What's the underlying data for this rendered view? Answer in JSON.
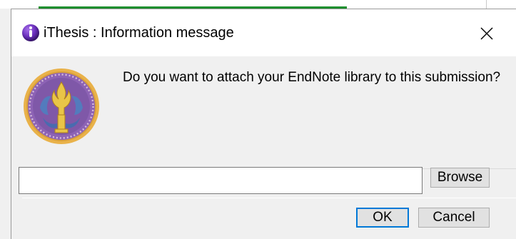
{
  "window": {
    "title": "iThesis : Information message",
    "app_icon": "ithesis-app-icon",
    "close_icon": "close-icon"
  },
  "message": {
    "text": "Do you want to attach your EndNote library to this submission?"
  },
  "logo": {
    "icon": "university-emblem",
    "colors": {
      "outer_ring": "#e9b24a",
      "inner_disc": "#7f58a8",
      "emblem": "#e9c547"
    }
  },
  "file_picker": {
    "value": "",
    "browse_label": "Browse"
  },
  "actions": {
    "ok_label": "OK",
    "cancel_label": "Cancel"
  },
  "colors": {
    "dialog_bg": "#f0f0f0",
    "titlebar_bg": "#ffffff",
    "default_button_border": "#0078d7",
    "underlay_progress": "#1e8f2e"
  }
}
